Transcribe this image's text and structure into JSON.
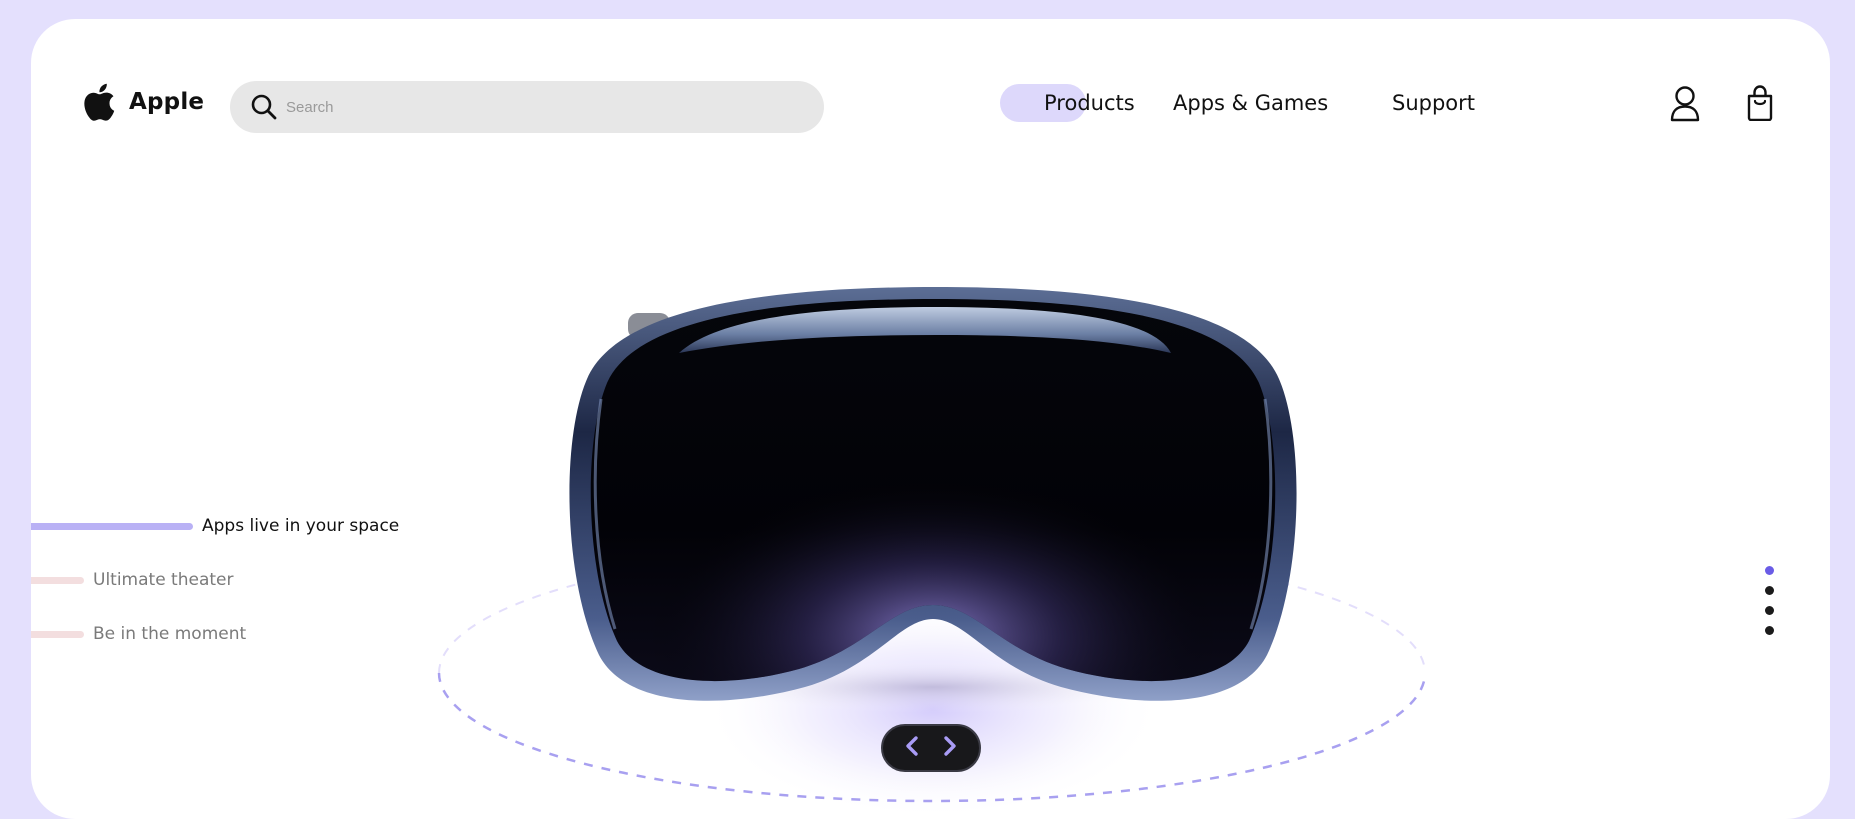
{
  "brand": {
    "name": "Apple",
    "logo_icon": "apple-logo-icon"
  },
  "search": {
    "placeholder": "Search",
    "value": "",
    "icon": "search-icon"
  },
  "nav": {
    "items": [
      {
        "label": "Products",
        "active": true
      },
      {
        "label": "Apps & Games",
        "active": false
      },
      {
        "label": "Support",
        "active": false
      }
    ]
  },
  "header_icons": {
    "account": "user-icon",
    "cart": "shopping-bag-icon"
  },
  "features": [
    {
      "label": "Apps live in your space",
      "active": true
    },
    {
      "label": "Ultimate theater",
      "active": false
    },
    {
      "label": "Be in the moment",
      "active": false
    }
  ],
  "hero": {
    "product_image": "headset-visor-image"
  },
  "carousel": {
    "prev_icon": "chevron-left-icon",
    "next_icon": "chevron-right-icon"
  },
  "pagination": {
    "total": 4,
    "active_index": 0
  },
  "colors": {
    "background": "#e4e0fd",
    "card": "#ffffff",
    "accent": "#6a5ce6",
    "accent_light": "#ddd8fb",
    "search_bg": "#e7e7e7",
    "control_bg": "#18181b"
  }
}
